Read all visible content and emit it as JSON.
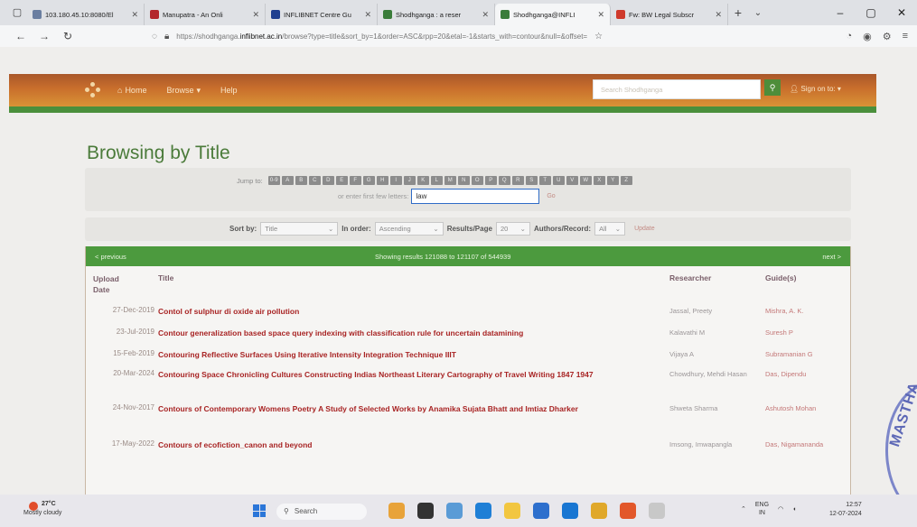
{
  "browser": {
    "tabs": [
      {
        "label": "103.180.45.10:8080/El",
        "color": "#6a7ea0",
        "active": false
      },
      {
        "label": "Manupatra - An Onli",
        "color": "#b3262c",
        "active": false
      },
      {
        "label": "INFLIBNET Centre Gu",
        "color": "#1f3f8f",
        "active": false
      },
      {
        "label": "Shodhganga : a reser",
        "color": "#3a7c3a",
        "active": false
      },
      {
        "label": "Shodhganga@INFLI",
        "color": "#3a7c3a",
        "active": true
      },
      {
        "label": "Fw: BW Legal Subscr",
        "color": "#cf3a2c",
        "active": false
      }
    ],
    "url_prefix": "https://shodhganga.",
    "url_host": "inflibnet.ac.in",
    "url_rest": "/browse?type=title&sort_by=1&order=ASC&rpp=20&etal=-1&starts_with=contour&null=&offset="
  },
  "site": {
    "nav": {
      "home": "Home",
      "browse": "Browse",
      "help": "Help"
    },
    "search_placeholder": "Search Shodhganga",
    "signin": "Sign on to:"
  },
  "page": {
    "title": "Browsing by Title",
    "jump_label": "Jump to:",
    "letters": [
      "0-9",
      "A",
      "B",
      "C",
      "D",
      "E",
      "F",
      "G",
      "H",
      "I",
      "J",
      "K",
      "L",
      "M",
      "N",
      "O",
      "P",
      "Q",
      "R",
      "S",
      "T",
      "U",
      "V",
      "W",
      "X",
      "Y",
      "Z"
    ],
    "enter_label": "or enter first few letters:",
    "enter_value": "law",
    "go_label": "Go",
    "sort": {
      "sort_by_label": "Sort by:",
      "sort_by_value": "Title",
      "order_label": "In order:",
      "order_value": "Ascending",
      "rpp_label": "Results/Page",
      "rpp_value": "20",
      "authors_label": "Authors/Record:",
      "authors_value": "All",
      "update_label": "Update"
    },
    "results": {
      "prev": "< previous",
      "showing": "Showing results 121088 to 121107 of 544939",
      "next": "next >",
      "headers": {
        "date_1": "Upload",
        "date_2": "Date",
        "title": "Title",
        "researcher": "Researcher",
        "guide": "Guide(s)"
      },
      "rows": [
        {
          "date": "27-Dec-2019",
          "title": "Contol of sulphur di oxide air pollution",
          "researcher": "Jassal, Preety",
          "guide": "Mishra, A. K."
        },
        {
          "date": "23-Jul-2019",
          "title": "Contour generalization based space query indexing with classification rule for uncertain datamining",
          "researcher": "Kalavathi M",
          "guide": "Suresh P"
        },
        {
          "date": "15-Feb-2019",
          "title": "Contouring Reflective Surfaces Using Iterative Intensity Integration Technique IIIT",
          "researcher": "Vijaya A",
          "guide": "Subramanian G"
        },
        {
          "date": "20-Mar-2024",
          "title": "Contouring Space Chronicling Cultures Constructing Indias Northeast Literary Cartography of Travel Writing 1847 1947",
          "researcher": "Chowdhury, Mehdi Hasan",
          "guide": "Das, Dipendu"
        },
        {
          "date": "24-Nov-2017",
          "title": "Contours of Contemporary Womens Poetry A Study of Selected Works by Anamika Sujata Bhatt and Imtiaz Dharker",
          "researcher": "Shweta Sharma",
          "guide": "Ashutosh Mohan"
        },
        {
          "date": "17-May-2022",
          "title": "Contours of ecofiction_canon and beyond",
          "researcher": "Imsong, Imwapangla",
          "guide": "Das, Nigamananda"
        }
      ]
    },
    "stamp_text": "MASTHA"
  },
  "taskbar": {
    "temp": "27°C",
    "weather": "Mostly cloudy",
    "search": "Search",
    "lang_1": "ENG",
    "lang_2": "IN",
    "time": "12:57",
    "date": "12-07-2024"
  }
}
